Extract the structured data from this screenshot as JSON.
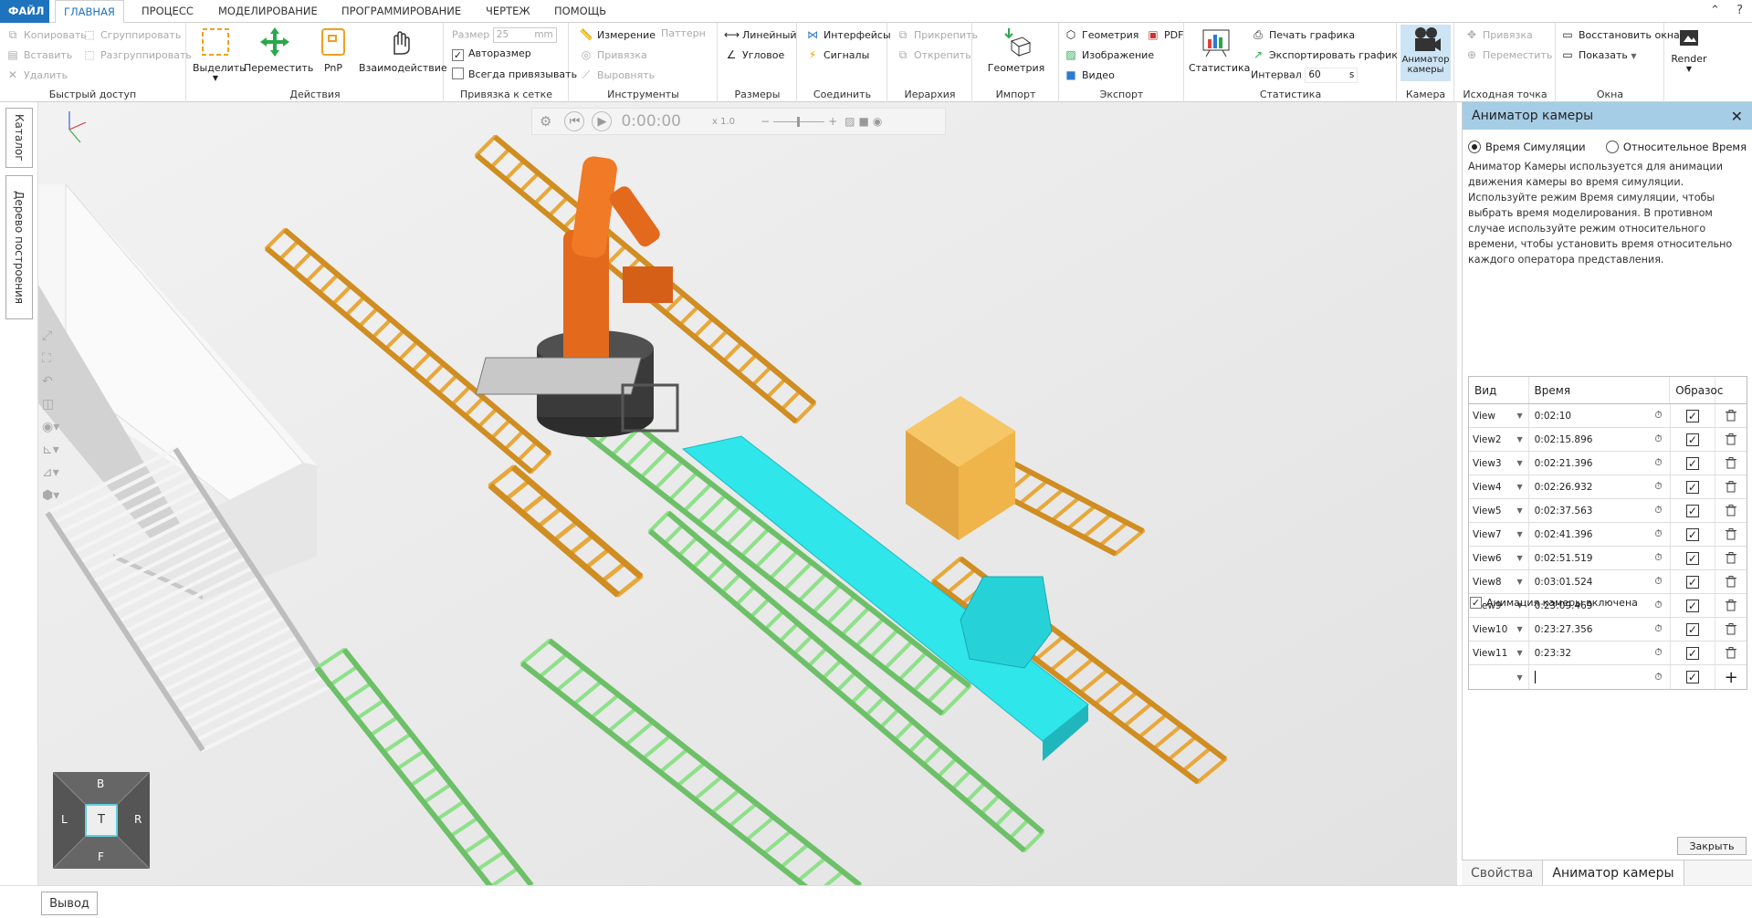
{
  "menu": {
    "tabs": [
      "ФАЙЛ",
      "ГЛАВНАЯ",
      "ПРОЦЕСС",
      "МОДЕЛИРОВАНИЕ",
      "ПРОГРАММИРОВАНИЕ",
      "ЧЕРТЕЖ",
      "ПОМОЩЬ"
    ],
    "active": "ГЛАВНАЯ"
  },
  "ribbon": {
    "quick_access": {
      "label": "Быстрый доступ",
      "copy": "Копировать",
      "group": "Сгруппировать",
      "paste": "Вставить",
      "ungroup": "Разгруппировать",
      "delete": "Удалить"
    },
    "actions": {
      "label": "Действия",
      "select": "Выделить",
      "move": "Переместить",
      "pnp": "PnP",
      "interaction": "Взаимодействие"
    },
    "grid": {
      "label": "Привязка к сетке",
      "size_label": "Размер",
      "size_value": "25",
      "size_unit": "mm",
      "autosize": "Авторазмер",
      "always_snap": "Всегда привязывать"
    },
    "tools": {
      "label": "Инструменты",
      "measure": "Измерение",
      "pattern": "Паттерн",
      "snap": "Привязка",
      "align": "Выровнять"
    },
    "dimensions": {
      "label": "Размеры",
      "linear": "Линейный",
      "angular": "Угловое"
    },
    "connect": {
      "label": "Соединить",
      "interfaces": "Интерфейсы",
      "signals": "Сигналы"
    },
    "hierarchy": {
      "label": "Иерархия",
      "attach": "Прикрепить",
      "detach": "Открепить"
    },
    "import": {
      "label": "Импорт",
      "geometry": "Геометрия"
    },
    "export": {
      "label": "Экспорт",
      "geometry": "Геометрия",
      "pdf": "PDF",
      "image": "Изображение",
      "video": "Видео"
    },
    "statistics": {
      "label": "Статистика",
      "stats": "Статистика",
      "print_chart": "Печать графика",
      "export_chart": "Экспортировать график",
      "interval_label": "Интервал",
      "interval_value": "60",
      "interval_unit": "s"
    },
    "camera": {
      "label": "Камера",
      "animator_line1": "Аниматор",
      "animator_line2": "камеры"
    },
    "origin": {
      "label": "Исходная точка",
      "snap": "Привязка",
      "move": "Переместить"
    },
    "windows": {
      "label": "Окна",
      "restore": "Восстановить окна",
      "show": "Показать"
    },
    "render": {
      "label": "Render"
    }
  },
  "left_tabs": [
    "Каталог",
    "Дерево построения"
  ],
  "sim": {
    "time": "0:00:00",
    "speed": "x 1.0"
  },
  "navcube": {
    "top": "B",
    "left": "L",
    "center": "T",
    "right": "R",
    "bottom": "F"
  },
  "panel": {
    "title": "Аниматор камеры",
    "radio_sim": "Время Симуляции",
    "radio_rel": "Относительное Время",
    "description": "Аниматор Камеры используется для анимации движения камеры во время симуляции. Используйте режим Время симуляции, чтобы выбрать время моделирования. В противном случае используйте режим относительного времени, чтобы установить время относительно каждого оператора представления.",
    "headers": {
      "view": "Вид",
      "time": "Время",
      "sample": "Образос"
    },
    "rows": [
      {
        "view": "View",
        "time": "0:02:10"
      },
      {
        "view": "View2",
        "time": "0:02:15.896"
      },
      {
        "view": "View3",
        "time": "0:02:21.396"
      },
      {
        "view": "View4",
        "time": "0:02:26.932"
      },
      {
        "view": "View5",
        "time": "0:02:37.563"
      },
      {
        "view": "View7",
        "time": "0:02:41.396"
      },
      {
        "view": "View6",
        "time": "0:02:51.519"
      },
      {
        "view": "View8",
        "time": "0:03:01.524"
      },
      {
        "view": "View9",
        "time": "0:23:09.469"
      },
      {
        "view": "View10",
        "time": "0:23:27.356"
      },
      {
        "view": "View11",
        "time": "0:23:32"
      }
    ],
    "anim_enabled": "Анимация камеры включена",
    "close": "Закрыть"
  },
  "panel_tabs": [
    "Свойства",
    "Аниматор камеры"
  ],
  "output": "Вывод",
  "colors": {
    "accent": "#1e73be",
    "panel_head": "#a6cde6",
    "conveyor_orange": "#e8a83a",
    "conveyor_green": "#8fe08a",
    "cyan": "#2fe6ea",
    "box": "#f0b54a"
  }
}
